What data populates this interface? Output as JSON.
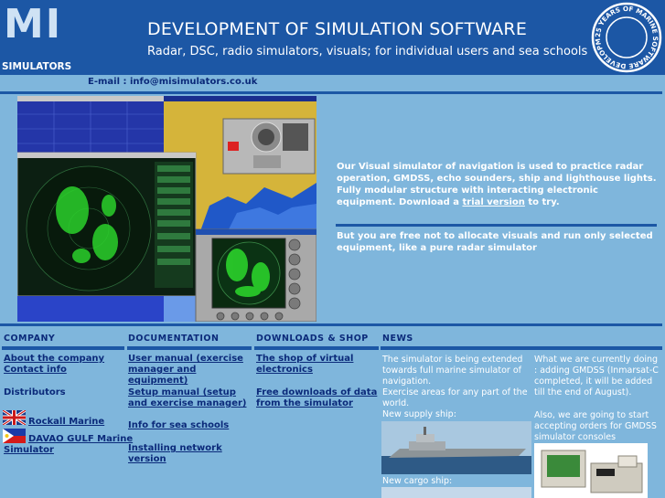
{
  "header": {
    "logo_letters": "MI",
    "logo_label": "SIMULATORS",
    "title": "DEVELOPMENT OF SIMULATION SOFTWARE",
    "subtitle": "Radar, DSC, radio simulators, visuals; for individual users and sea schools",
    "seal_text": "25 YEARS OF MARINE SOFTWARE DEVELOPMENT"
  },
  "email": "E-mail : info@misimulators.co.uk",
  "intro": {
    "text_before": "Our Visual simulator of navigation is used to practice radar operation, GMDSS, echo sounders, ship and lighthouse lights. Fully modular structure with interacting electronic equipment. Download a ",
    "link": "trial version",
    "text_after": " to try.",
    "text2": "But you are free not to allocate visuals and run only selected equipment, like a pure radar simulator"
  },
  "company": {
    "heading": "COMPANY",
    "about": "About the company",
    "contact": "Contact info",
    "distributors": "Distributors",
    "dist1": "Rockall Marine",
    "dist2": "DAVAO GULF Marine Simulator"
  },
  "documentation": {
    "heading": "DOCUMENTATION",
    "manual1": "User manual (exercise manager and equipment)",
    "manual2": "Setup manual (setup and exercise manager)",
    "info": "Info for sea schools",
    "install": "Installing network version"
  },
  "downloads": {
    "heading": "DOWNLOADS & SHOP",
    "shop": "The shop of virtual electronics",
    "free": "Free downloads of data from the simulator"
  },
  "news": {
    "heading": "NEWS",
    "left_text": "The simulator is being extended towards full marine simulator of navigation.",
    "left_text2": "Exercise areas for any part of the world.",
    "supply": "New supply ship:",
    "cargo": "New cargo ship:",
    "right_text": "What we are currently doing : adding GMDSS (Inmarsat-C completed, it will be added till the end of August).",
    "right_text2": "Also, we are going to start accepting orders for GMDSS simulator consoles"
  },
  "colors": {
    "header_bg": "#1c57a5",
    "page_bg": "#7fb6dc",
    "link": "#0b2a7a",
    "radar_green": "#2bd12b"
  }
}
